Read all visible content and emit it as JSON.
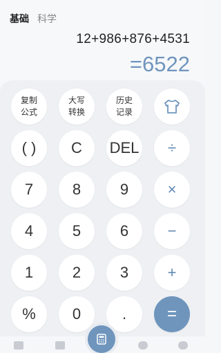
{
  "tabs": {
    "basic": "基础",
    "science": "科学"
  },
  "display": {
    "expression": "12+986+876+4531",
    "result": "=6522"
  },
  "keys": {
    "copy_formula_1": "复制",
    "copy_formula_2": "公式",
    "uppercase_1": "大写",
    "uppercase_2": "转换",
    "history_1": "历史",
    "history_2": "记录",
    "paren": "( )",
    "clear": "C",
    "del": "DEL",
    "divide": "÷",
    "n7": "7",
    "n8": "8",
    "n9": "9",
    "multiply": "×",
    "n4": "4",
    "n5": "5",
    "n6": "6",
    "minus": "−",
    "n1": "1",
    "n2": "2",
    "n3": "3",
    "plus": "+",
    "percent": "%",
    "n0": "0",
    "dot": ".",
    "equals": "="
  },
  "icons": {
    "shirt": "shirt-icon",
    "calculator": "calculator-icon"
  }
}
